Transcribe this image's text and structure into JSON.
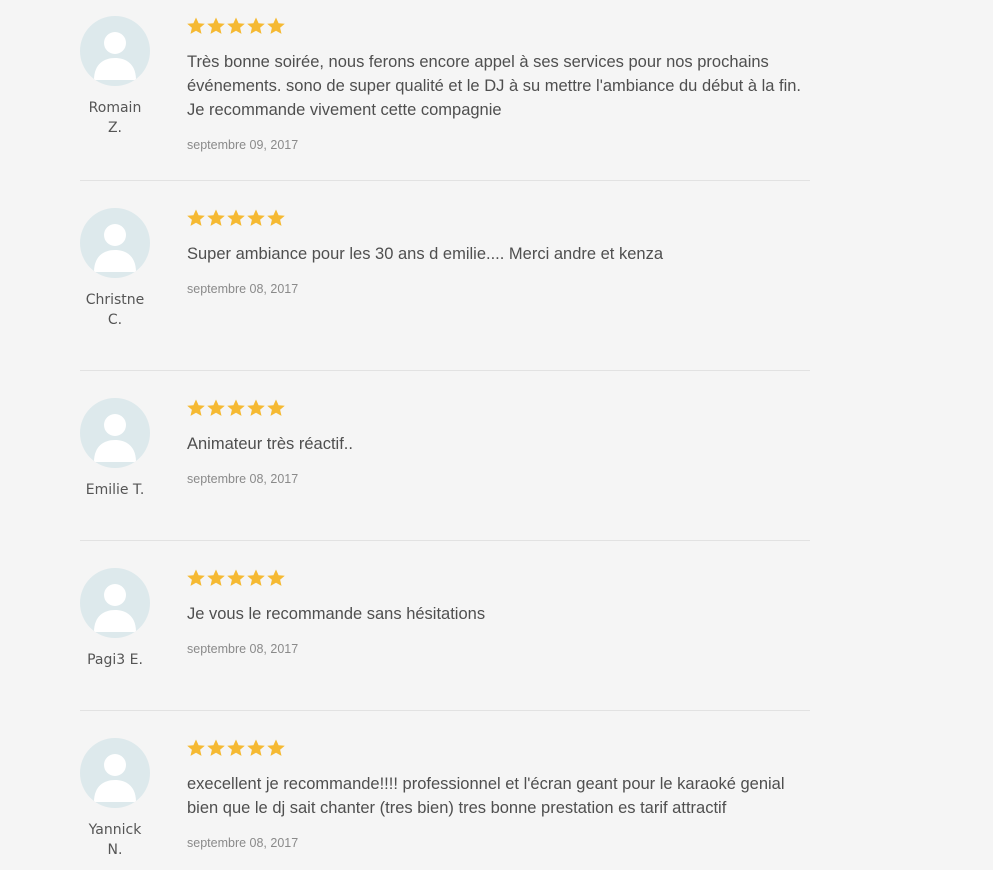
{
  "reviews": [
    {
      "author_line1": "Romain",
      "author_line2": "Z.",
      "rating": 5,
      "text": "Très bonne soirée, nous ferons encore appel à ses services pour nos prochains événements. sono de super qualité et le DJ à su mettre l'ambiance du début à la fin. Je recommande vivement cette compagnie",
      "date": "septembre 09, 2017"
    },
    {
      "author_line1": "Christne",
      "author_line2": "C.",
      "rating": 5,
      "text": "Super ambiance pour les 30 ans d emilie.... Merci andre et kenza",
      "date": "septembre 08, 2017"
    },
    {
      "author_line1": "Emilie T.",
      "author_line2": "",
      "rating": 5,
      "text": "Animateur très réactif..",
      "date": "septembre 08, 2017"
    },
    {
      "author_line1": "Pagi3 E.",
      "author_line2": "",
      "rating": 5,
      "text": "Je vous le recommande sans hésitations",
      "date": "septembre 08, 2017"
    },
    {
      "author_line1": "Yannick",
      "author_line2": "N.",
      "rating": 5,
      "text": "execellent je recommande!!!! professionnel et l'écran geant pour le karaoké genial bien que le dj sait chanter (tres bien) tres bonne prestation es tarif attractif",
      "date": "septembre 08, 2017"
    }
  ],
  "colors": {
    "star": "#f5b932",
    "avatar_bg": "#dde9ec",
    "avatar_figure": "#ffffff",
    "separator": "#e2e2e2"
  },
  "icons": {
    "avatar": "user-silhouette-icon",
    "star": "star-icon"
  }
}
